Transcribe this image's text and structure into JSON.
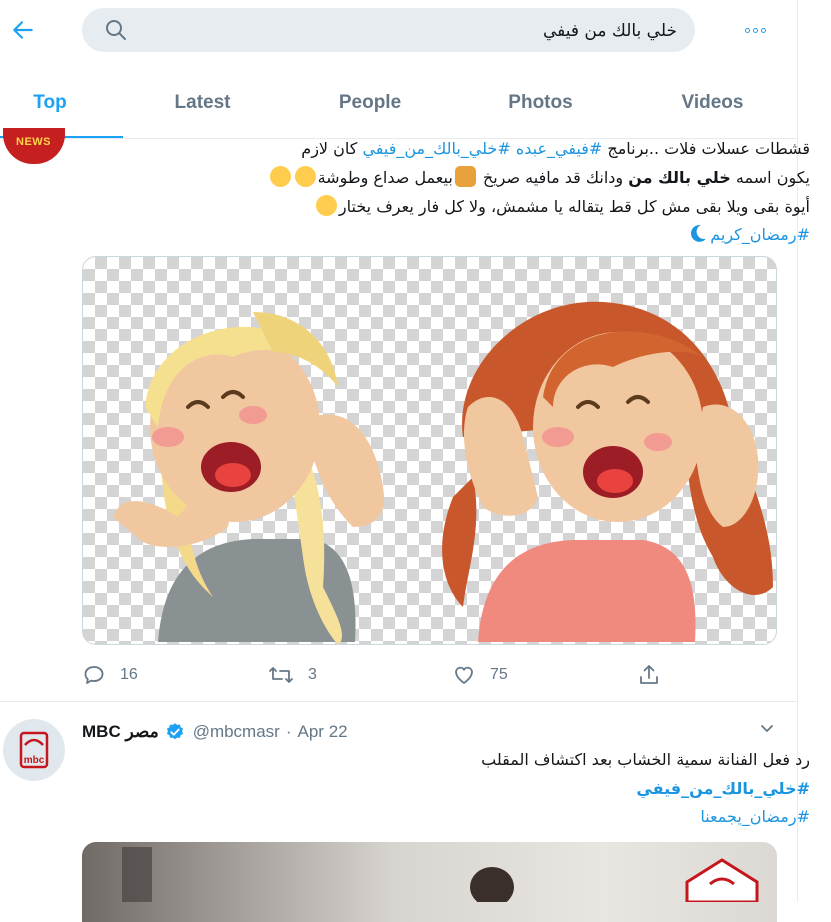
{
  "search": {
    "query": "خلي بالك من فيفي"
  },
  "icons": {
    "back": "arrow-left-icon",
    "search": "magnifier-icon",
    "more": "three-dots-icon",
    "reply": "speech-bubble-icon",
    "retweet": "retweet-arrows-icon",
    "like": "heart-icon",
    "share": "share-upload-icon",
    "verified": "verified-badge-icon",
    "caret": "chevron-down-icon"
  },
  "tabs": [
    {
      "label": "Top",
      "active": true
    },
    {
      "label": "Latest"
    },
    {
      "label": "People"
    },
    {
      "label": "Photos"
    },
    {
      "label": "Videos"
    }
  ],
  "tweet1": {
    "avatar_text": "NEWS",
    "line1_plain": "قشطات عسلات فلات ..برنامج ",
    "line1_tag1": "#فيفي_عبده",
    "line1_tag2": "#خلي_بالك_من_فيفي",
    "line1_end": " كان لازم",
    "line2_a": "يكون اسمه ",
    "line2_bold": "خلي بالك من",
    "line2_b": " ودانك قد مافيه صريخ ",
    "line2_c": "بيعمل صداع وطوشة",
    "line3": "أيوة بقى ويلا بقى مش كل قط يتقاله يا مشمش، ولا كل فار يعرف يختار",
    "line4_tag": "#رمضان_كريم",
    "stats": {
      "replies": "16",
      "retweets": "3",
      "likes": "75"
    }
  },
  "tweet2": {
    "avatar_text": "mbc",
    "name": "MBC مصر",
    "handle": "@mbcmasr",
    "separator": "·",
    "date": "Apr 22",
    "line1": "رد فعل الفنانة سمية الخشاب بعد اكتشاف المقلب",
    "line2_tag": "#خلي_بالك_من_فيفي",
    "line3_tag": "#رمضان_يجمعنا"
  },
  "colors": {
    "accent": "#1da1f2",
    "hashtag": "#1b95e0",
    "muted": "#657786",
    "text": "#14171a",
    "border": "#e6ecf0"
  }
}
